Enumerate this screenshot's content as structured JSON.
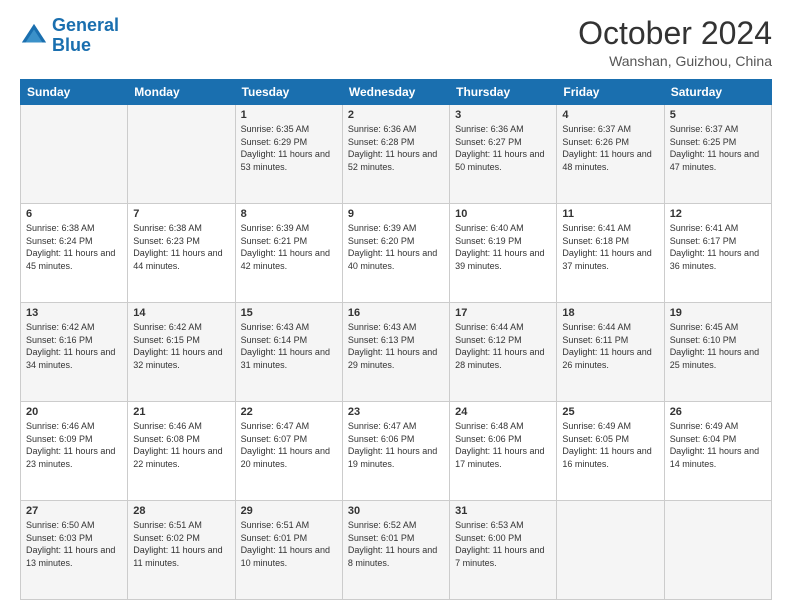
{
  "header": {
    "logo_line1": "General",
    "logo_line2": "Blue",
    "month_title": "October 2024",
    "location": "Wanshan, Guizhou, China"
  },
  "weekdays": [
    "Sunday",
    "Monday",
    "Tuesday",
    "Wednesday",
    "Thursday",
    "Friday",
    "Saturday"
  ],
  "weeks": [
    [
      {
        "day": "",
        "sunrise": "",
        "sunset": "",
        "daylight": ""
      },
      {
        "day": "",
        "sunrise": "",
        "sunset": "",
        "daylight": ""
      },
      {
        "day": "1",
        "sunrise": "Sunrise: 6:35 AM",
        "sunset": "Sunset: 6:29 PM",
        "daylight": "Daylight: 11 hours and 53 minutes."
      },
      {
        "day": "2",
        "sunrise": "Sunrise: 6:36 AM",
        "sunset": "Sunset: 6:28 PM",
        "daylight": "Daylight: 11 hours and 52 minutes."
      },
      {
        "day": "3",
        "sunrise": "Sunrise: 6:36 AM",
        "sunset": "Sunset: 6:27 PM",
        "daylight": "Daylight: 11 hours and 50 minutes."
      },
      {
        "day": "4",
        "sunrise": "Sunrise: 6:37 AM",
        "sunset": "Sunset: 6:26 PM",
        "daylight": "Daylight: 11 hours and 48 minutes."
      },
      {
        "day": "5",
        "sunrise": "Sunrise: 6:37 AM",
        "sunset": "Sunset: 6:25 PM",
        "daylight": "Daylight: 11 hours and 47 minutes."
      }
    ],
    [
      {
        "day": "6",
        "sunrise": "Sunrise: 6:38 AM",
        "sunset": "Sunset: 6:24 PM",
        "daylight": "Daylight: 11 hours and 45 minutes."
      },
      {
        "day": "7",
        "sunrise": "Sunrise: 6:38 AM",
        "sunset": "Sunset: 6:23 PM",
        "daylight": "Daylight: 11 hours and 44 minutes."
      },
      {
        "day": "8",
        "sunrise": "Sunrise: 6:39 AM",
        "sunset": "Sunset: 6:21 PM",
        "daylight": "Daylight: 11 hours and 42 minutes."
      },
      {
        "day": "9",
        "sunrise": "Sunrise: 6:39 AM",
        "sunset": "Sunset: 6:20 PM",
        "daylight": "Daylight: 11 hours and 40 minutes."
      },
      {
        "day": "10",
        "sunrise": "Sunrise: 6:40 AM",
        "sunset": "Sunset: 6:19 PM",
        "daylight": "Daylight: 11 hours and 39 minutes."
      },
      {
        "day": "11",
        "sunrise": "Sunrise: 6:41 AM",
        "sunset": "Sunset: 6:18 PM",
        "daylight": "Daylight: 11 hours and 37 minutes."
      },
      {
        "day": "12",
        "sunrise": "Sunrise: 6:41 AM",
        "sunset": "Sunset: 6:17 PM",
        "daylight": "Daylight: 11 hours and 36 minutes."
      }
    ],
    [
      {
        "day": "13",
        "sunrise": "Sunrise: 6:42 AM",
        "sunset": "Sunset: 6:16 PM",
        "daylight": "Daylight: 11 hours and 34 minutes."
      },
      {
        "day": "14",
        "sunrise": "Sunrise: 6:42 AM",
        "sunset": "Sunset: 6:15 PM",
        "daylight": "Daylight: 11 hours and 32 minutes."
      },
      {
        "day": "15",
        "sunrise": "Sunrise: 6:43 AM",
        "sunset": "Sunset: 6:14 PM",
        "daylight": "Daylight: 11 hours and 31 minutes."
      },
      {
        "day": "16",
        "sunrise": "Sunrise: 6:43 AM",
        "sunset": "Sunset: 6:13 PM",
        "daylight": "Daylight: 11 hours and 29 minutes."
      },
      {
        "day": "17",
        "sunrise": "Sunrise: 6:44 AM",
        "sunset": "Sunset: 6:12 PM",
        "daylight": "Daylight: 11 hours and 28 minutes."
      },
      {
        "day": "18",
        "sunrise": "Sunrise: 6:44 AM",
        "sunset": "Sunset: 6:11 PM",
        "daylight": "Daylight: 11 hours and 26 minutes."
      },
      {
        "day": "19",
        "sunrise": "Sunrise: 6:45 AM",
        "sunset": "Sunset: 6:10 PM",
        "daylight": "Daylight: 11 hours and 25 minutes."
      }
    ],
    [
      {
        "day": "20",
        "sunrise": "Sunrise: 6:46 AM",
        "sunset": "Sunset: 6:09 PM",
        "daylight": "Daylight: 11 hours and 23 minutes."
      },
      {
        "day": "21",
        "sunrise": "Sunrise: 6:46 AM",
        "sunset": "Sunset: 6:08 PM",
        "daylight": "Daylight: 11 hours and 22 minutes."
      },
      {
        "day": "22",
        "sunrise": "Sunrise: 6:47 AM",
        "sunset": "Sunset: 6:07 PM",
        "daylight": "Daylight: 11 hours and 20 minutes."
      },
      {
        "day": "23",
        "sunrise": "Sunrise: 6:47 AM",
        "sunset": "Sunset: 6:06 PM",
        "daylight": "Daylight: 11 hours and 19 minutes."
      },
      {
        "day": "24",
        "sunrise": "Sunrise: 6:48 AM",
        "sunset": "Sunset: 6:06 PM",
        "daylight": "Daylight: 11 hours and 17 minutes."
      },
      {
        "day": "25",
        "sunrise": "Sunrise: 6:49 AM",
        "sunset": "Sunset: 6:05 PM",
        "daylight": "Daylight: 11 hours and 16 minutes."
      },
      {
        "day": "26",
        "sunrise": "Sunrise: 6:49 AM",
        "sunset": "Sunset: 6:04 PM",
        "daylight": "Daylight: 11 hours and 14 minutes."
      }
    ],
    [
      {
        "day": "27",
        "sunrise": "Sunrise: 6:50 AM",
        "sunset": "Sunset: 6:03 PM",
        "daylight": "Daylight: 11 hours and 13 minutes."
      },
      {
        "day": "28",
        "sunrise": "Sunrise: 6:51 AM",
        "sunset": "Sunset: 6:02 PM",
        "daylight": "Daylight: 11 hours and 11 minutes."
      },
      {
        "day": "29",
        "sunrise": "Sunrise: 6:51 AM",
        "sunset": "Sunset: 6:01 PM",
        "daylight": "Daylight: 11 hours and 10 minutes."
      },
      {
        "day": "30",
        "sunrise": "Sunrise: 6:52 AM",
        "sunset": "Sunset: 6:01 PM",
        "daylight": "Daylight: 11 hours and 8 minutes."
      },
      {
        "day": "31",
        "sunrise": "Sunrise: 6:53 AM",
        "sunset": "Sunset: 6:00 PM",
        "daylight": "Daylight: 11 hours and 7 minutes."
      },
      {
        "day": "",
        "sunrise": "",
        "sunset": "",
        "daylight": ""
      },
      {
        "day": "",
        "sunrise": "",
        "sunset": "",
        "daylight": ""
      }
    ]
  ]
}
